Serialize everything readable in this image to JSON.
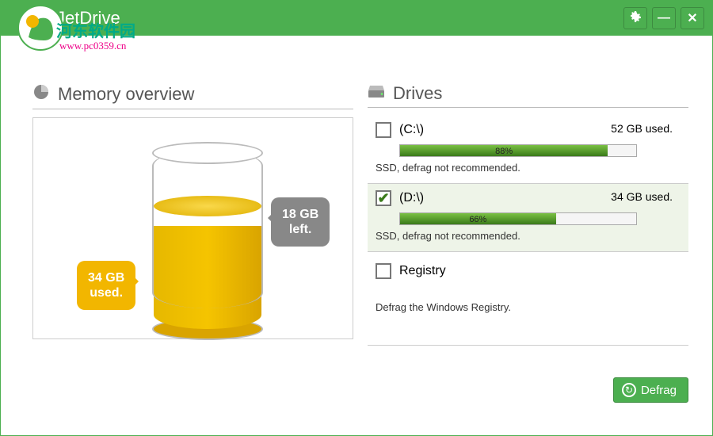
{
  "app": {
    "title": "JetDrive"
  },
  "watermark": {
    "line1": "河东软件园",
    "line2": "www.pc0359.cn"
  },
  "sections": {
    "memory": {
      "title": "Memory overview"
    },
    "drives": {
      "title": "Drives"
    }
  },
  "memory": {
    "used": {
      "value": "34 GB",
      "label": "used."
    },
    "free": {
      "value": "18 GB",
      "label": "left."
    }
  },
  "drives": [
    {
      "letter": "(C:\\)",
      "used_text": "52 GB used.",
      "percent": 88,
      "percent_label": "88%",
      "note": "SSD, defrag not recommended.",
      "checked": false
    },
    {
      "letter": "(D:\\)",
      "used_text": "34 GB used.",
      "percent": 66,
      "percent_label": "66%",
      "note": "SSD, defrag not recommended.",
      "checked": true
    }
  ],
  "registry": {
    "label": "Registry",
    "note": "Defrag the Windows Registry.",
    "checked": false
  },
  "buttons": {
    "defrag": "Defrag"
  },
  "colors": {
    "brand": "#4caf50",
    "accent_yellow": "#f2b600"
  }
}
